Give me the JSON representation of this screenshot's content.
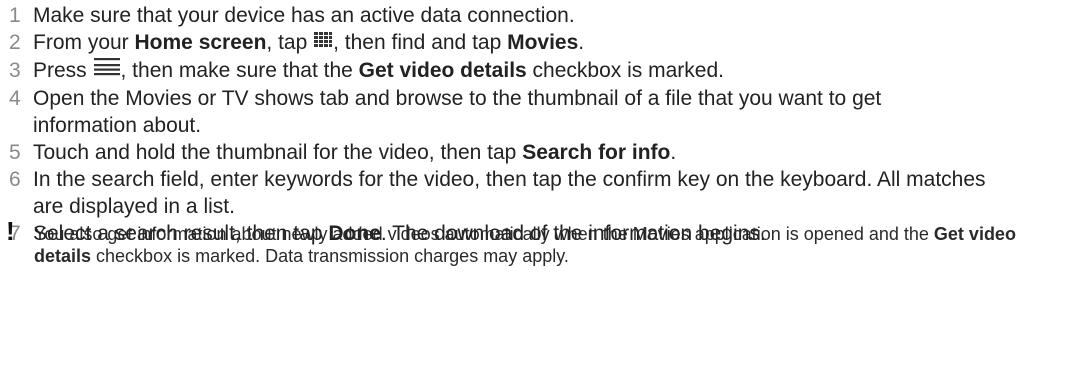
{
  "steps": [
    {
      "number": "1",
      "parts": {
        "t1": "Make sure that your device has an active data connection."
      }
    },
    {
      "number": "2",
      "parts": {
        "t1": "From your ",
        "b1": "Home screen",
        "t2": ", tap ",
        "icon": "apps-grid-icon",
        "t3": ", then find and tap ",
        "b2": "Movies",
        "t4": "."
      }
    },
    {
      "number": "3",
      "parts": {
        "t1": "Press ",
        "icon": "menu-icon",
        "t2": ", then make sure that the ",
        "b1": "Get video details",
        "t3": " checkbox is marked."
      }
    },
    {
      "number": "4",
      "parts": {
        "t1": "Open the Movies or TV shows tab and browse to the thumbnail of a file that you want to get information about."
      }
    },
    {
      "number": "5",
      "parts": {
        "t1": "Touch and hold the thumbnail for the video, then tap ",
        "b1": "Search for info",
        "t2": "."
      }
    },
    {
      "number": "6",
      "parts": {
        "t1": "In the search field, enter keywords for the video, then tap the confirm key on the keyboard. All matches are displayed in a list."
      }
    },
    {
      "number": "7",
      "parts": {
        "t1": "Select a search result, then tap ",
        "b1": "Done",
        "t2": ". The download of the information begins."
      }
    }
  ],
  "note": {
    "mark": "!",
    "icon": "exclamation-icon",
    "t1": "You also get information about newly added videos automatically when the Movies application is opened and the ",
    "b1": "Get video details",
    "t2": " checkbox is marked. Data transmission charges may apply."
  },
  "colors": {
    "text": "#222222",
    "step_number": "#8a8a8a",
    "icon": "#333333"
  }
}
